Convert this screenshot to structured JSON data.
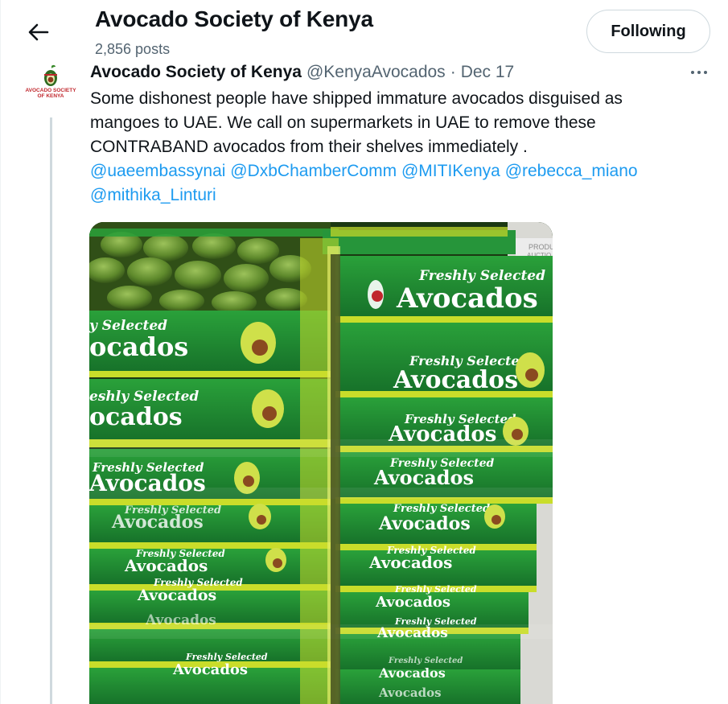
{
  "header": {
    "title": "Avocado Society of Kenya",
    "posts_count": "2,856 posts",
    "follow_button": "Following"
  },
  "tweet": {
    "author_name": "Avocado Society of Kenya",
    "author_handle": "@KenyaAvocados",
    "separator": "·",
    "date": "Dec 17",
    "avatar_text_1": "AVOCADO SOCIETY",
    "avatar_text_2": "OF KENYA",
    "text_lines": [
      "Some dishonest people have shipped immature avocados disguised as",
      "mangoes to UAE. We call on supermarkets in UAE to  remove these",
      "CONTRABAND  avocados from their shelves  immediately ."
    ],
    "mentions": [
      "@uaeembassynai",
      "@DxbChamberComm",
      "@MITIKenya",
      "@rebecca_miano",
      "@mithika_Linturi"
    ]
  },
  "media": {
    "box_text_1": "Freshly Selected",
    "box_text_2": "Avocados",
    "box_text_1_partial": "y Selected",
    "box_text_2_partial": "ocados",
    "box_text_1_partial_b": "eshly Selected",
    "box_text_2_partial_b": "ocados",
    "box_text_2_partial_c": "Avocados",
    "side_label": "PRODU",
    "side_label_2": "AUCTIO"
  },
  "colors": {
    "text_primary": "#0f1419",
    "text_secondary": "#536471",
    "link": "#1d9bf0",
    "border": "#cfd9de",
    "box_green": "#1f8a2e",
    "box_yellow": "#c9dd2a"
  },
  "icons": {
    "back": "arrow-left-icon",
    "more": "more-horizontal-icon"
  }
}
